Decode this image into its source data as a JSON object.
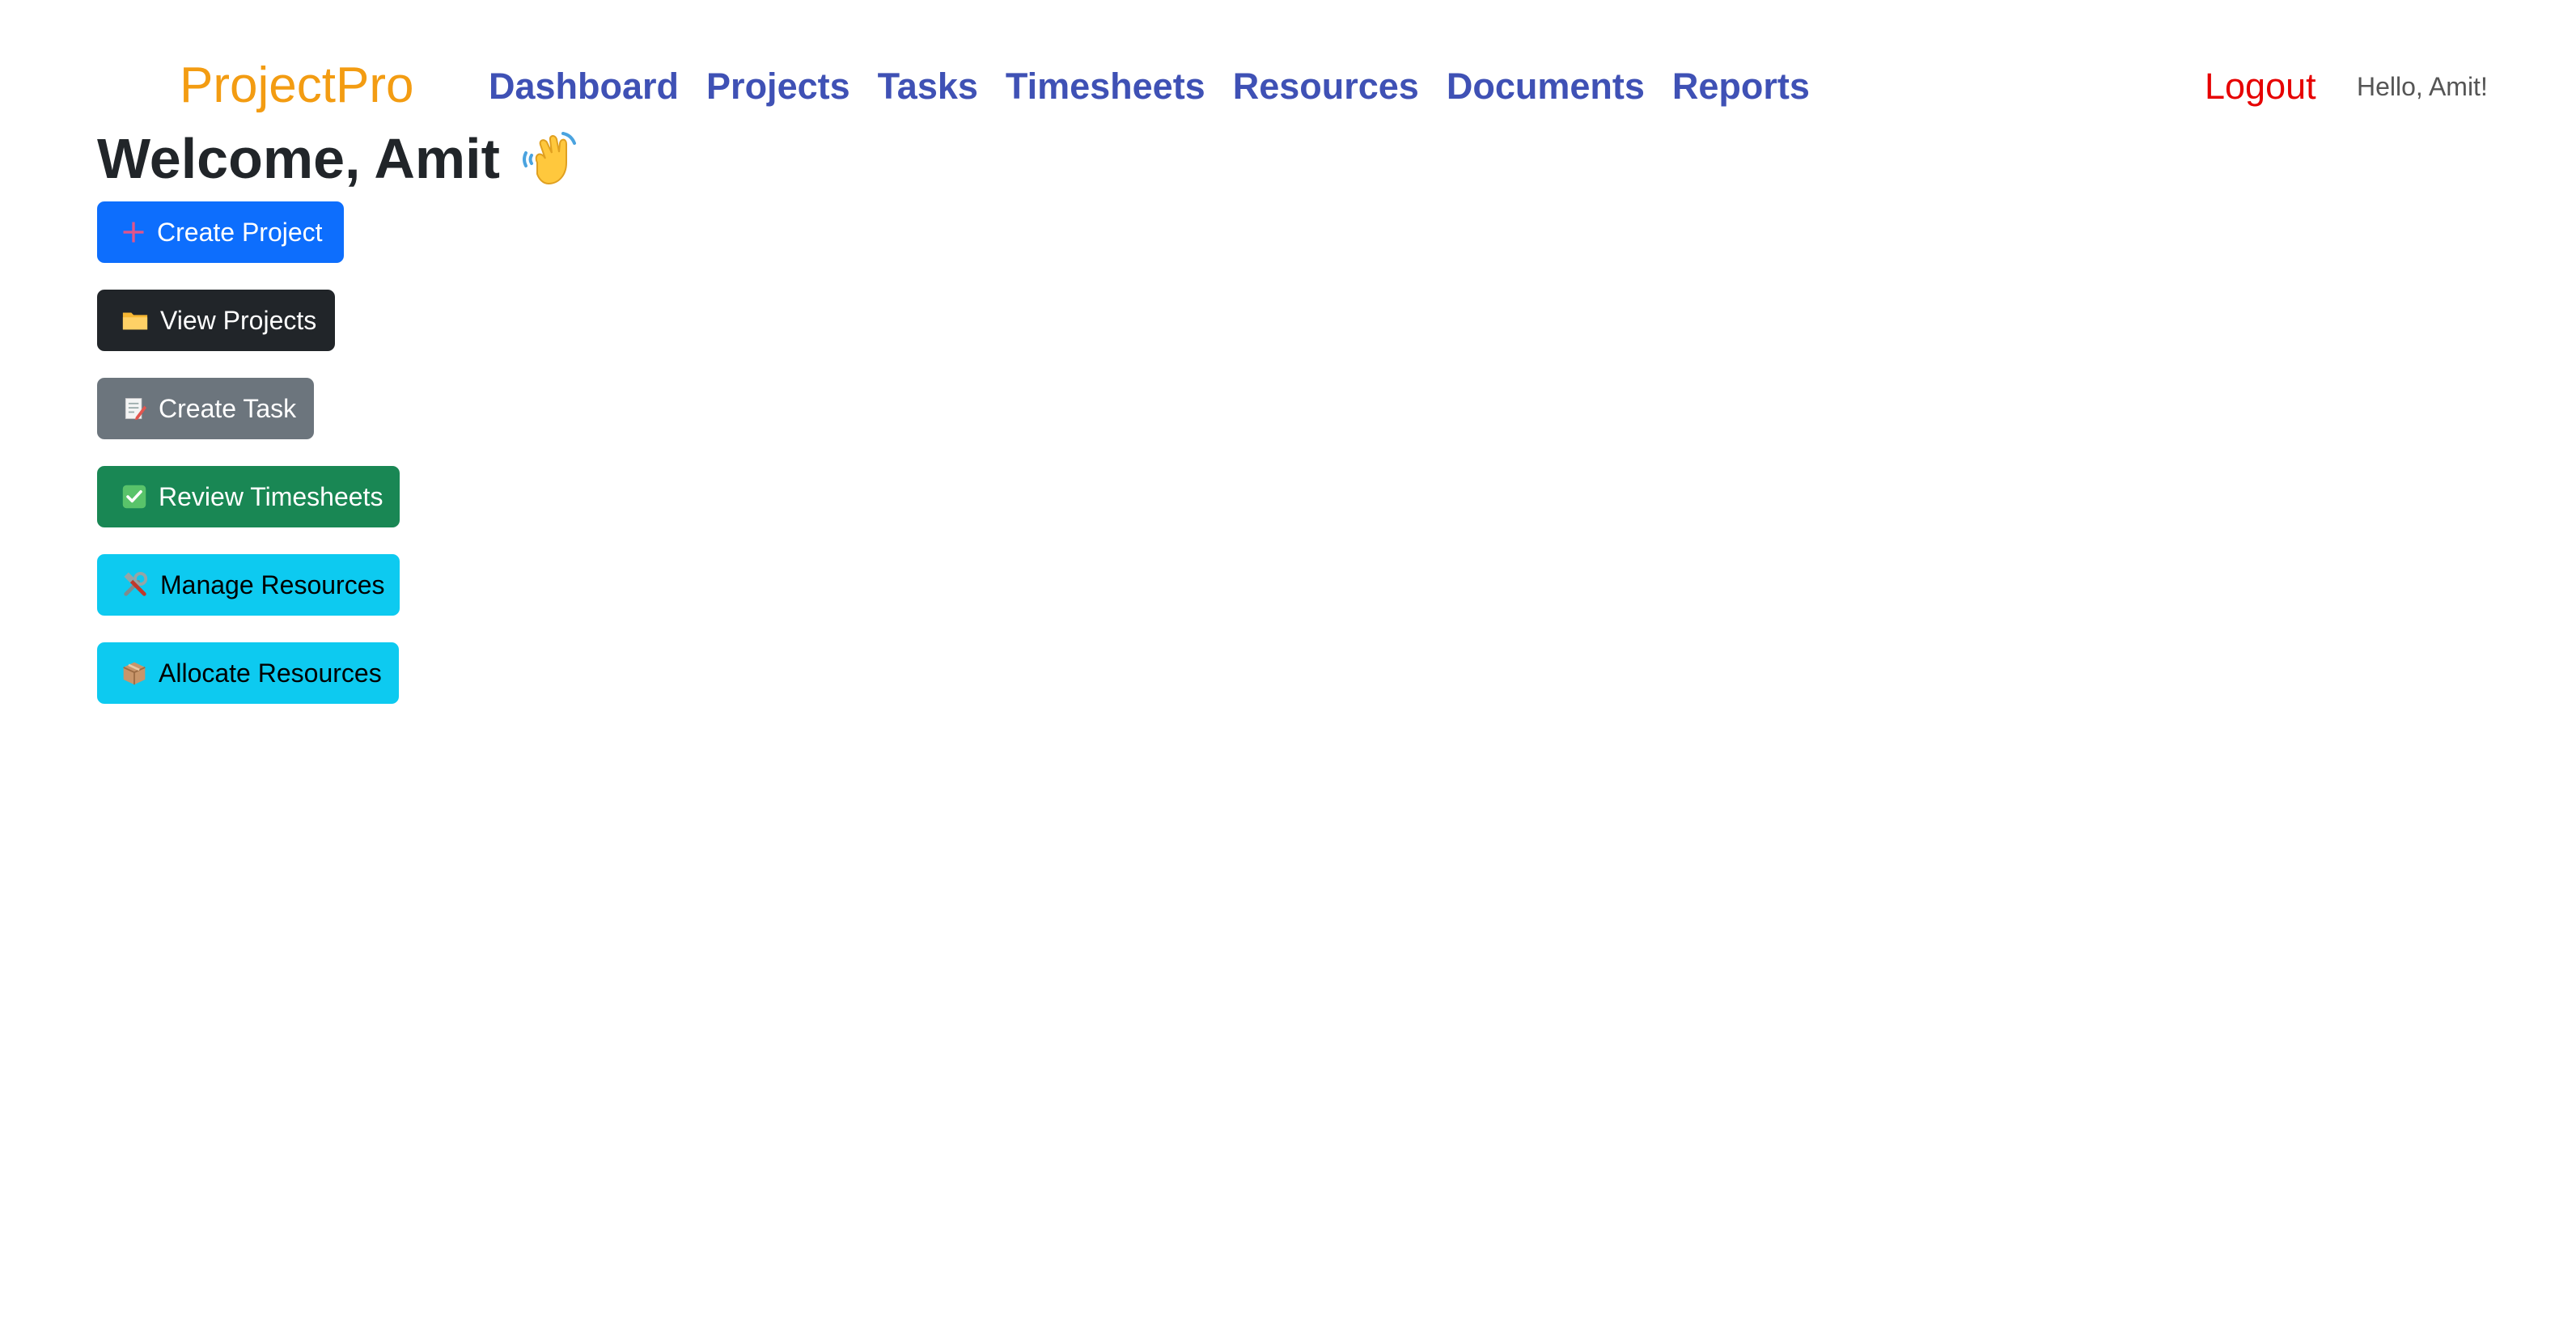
{
  "brand": {
    "name": "ProjectPro",
    "color": "#f39c12"
  },
  "nav": {
    "links": [
      {
        "label": "Dashboard"
      },
      {
        "label": "Projects"
      },
      {
        "label": "Tasks"
      },
      {
        "label": "Timesheets"
      },
      {
        "label": "Resources"
      },
      {
        "label": "Documents"
      },
      {
        "label": "Reports"
      }
    ],
    "logout_label": "Logout",
    "greeting": "Hello, Amit!"
  },
  "welcome": {
    "text": "Welcome, Amit",
    "icon": "waving-hand-icon"
  },
  "actions": [
    {
      "label": "Create Project",
      "icon": "plus-icon",
      "color": "#0d6efd"
    },
    {
      "label": "View Projects",
      "icon": "folder-icon",
      "color": "#212529"
    },
    {
      "label": "Create Task",
      "icon": "memo-icon",
      "color": "#6c757d"
    },
    {
      "label": "Review Timesheets",
      "icon": "check-mark-icon",
      "color": "#198754"
    },
    {
      "label": "Manage Resources",
      "icon": "tools-icon",
      "color": "#0dcaf0"
    },
    {
      "label": "Allocate Resources",
      "icon": "package-icon",
      "color": "#0dcaf0"
    }
  ]
}
